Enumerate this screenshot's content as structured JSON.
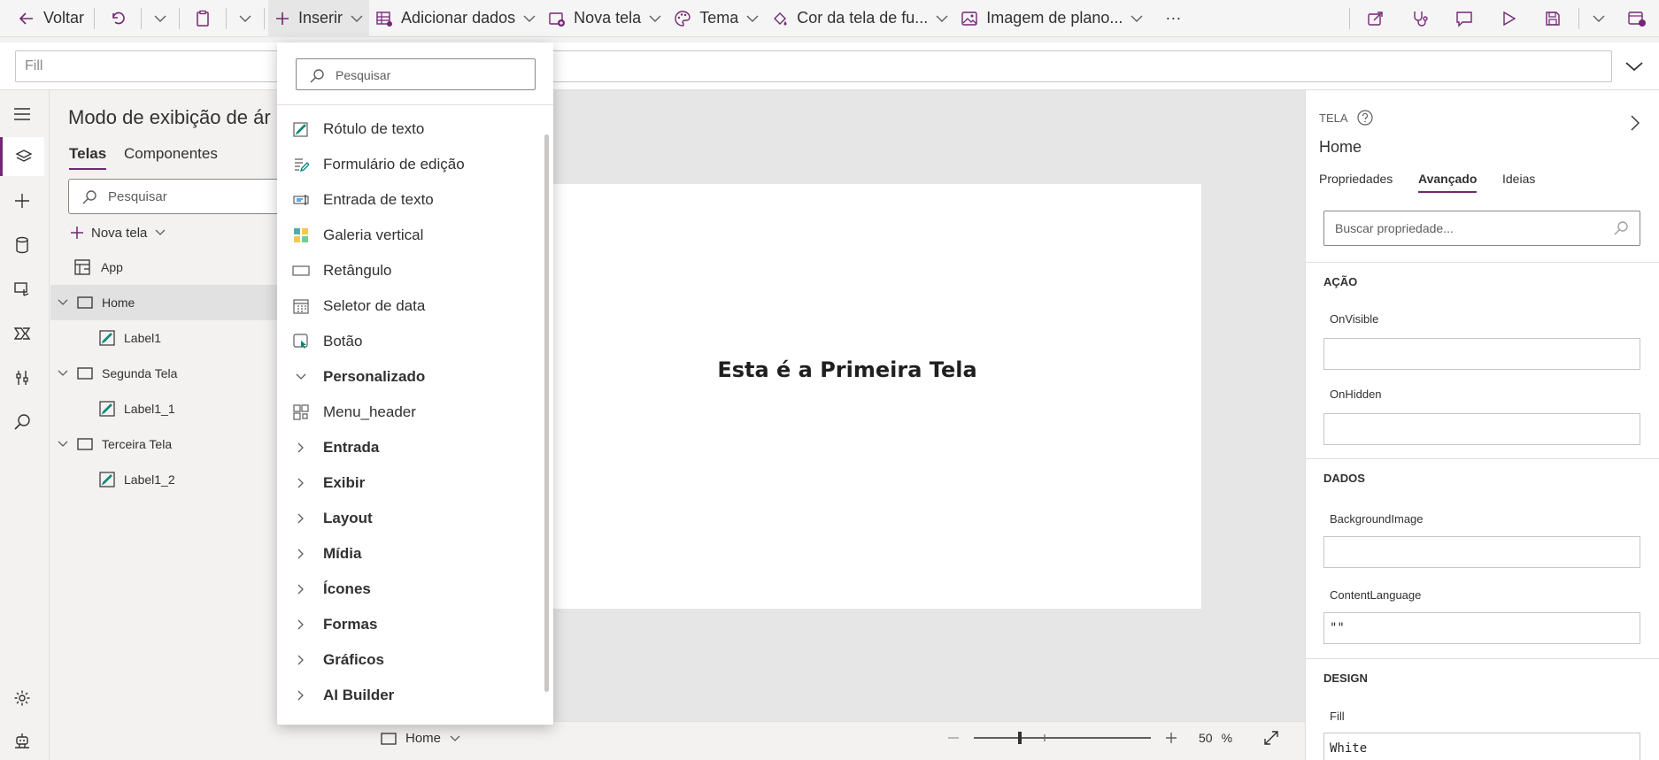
{
  "toolbar": {
    "back": "Voltar",
    "insert": "Inserir",
    "add_data": "Adicionar dados",
    "new_screen": "Nova tela",
    "theme": "Tema",
    "bg_color": "Cor da tela de fu...",
    "bg_image": "Imagem de plano...",
    "more": "···"
  },
  "formula": {
    "property": "Fill"
  },
  "tree": {
    "title": "Modo de exibição de ár",
    "tabs": [
      "Telas",
      "Componentes"
    ],
    "search_placeholder": "Pesquisar",
    "new_screen": "Nova tela",
    "items": [
      {
        "label": "App",
        "type": "app"
      },
      {
        "label": "Home",
        "type": "screen"
      },
      {
        "label": "Label1",
        "type": "label"
      },
      {
        "label": "Segunda Tela",
        "type": "screen"
      },
      {
        "label": "Label1_1",
        "type": "label"
      },
      {
        "label": "Terceira Tela",
        "type": "screen"
      },
      {
        "label": "Label1_2",
        "type": "label"
      }
    ]
  },
  "canvas": {
    "label": "Esta é a Primeira Tela"
  },
  "bottombar": {
    "screen": "Home",
    "zoom": "50",
    "zoom_unit": "%"
  },
  "flyout": {
    "search_placeholder": "Pesquisar",
    "items": [
      {
        "label": "Rótulo de texto",
        "icon": "text-label-icon"
      },
      {
        "label": "Formulário de edição",
        "icon": "edit-form-icon"
      },
      {
        "label": "Entrada de texto",
        "icon": "text-input-icon"
      },
      {
        "label": "Galeria vertical",
        "icon": "gallery-icon"
      },
      {
        "label": "Retângulo",
        "icon": "rectangle-icon"
      },
      {
        "label": "Seletor de data",
        "icon": "calendar-icon"
      },
      {
        "label": "Botão",
        "icon": "button-icon"
      }
    ],
    "custom_category": "Personalizado",
    "custom_item": "Menu_header",
    "categories": [
      "Entrada",
      "Exibir",
      "Layout",
      "Mídia",
      "Ícones",
      "Formas",
      "Gráficos",
      "AI Builder"
    ]
  },
  "props": {
    "kind": "TELA",
    "name": "Home",
    "tabs": [
      "Propriedades",
      "Avançado",
      "Ideias"
    ],
    "search_placeholder": "Buscar propriedade...",
    "sections": {
      "action": "AÇÃO",
      "data": "DADOS",
      "design": "DESIGN"
    },
    "fields": {
      "on_visible": "OnVisible",
      "on_hidden": "OnHidden",
      "background_image": "BackgroundImage",
      "content_language": "ContentLanguage",
      "content_language_value": "\"\"",
      "fill": "Fill",
      "fill_value": "White"
    }
  }
}
